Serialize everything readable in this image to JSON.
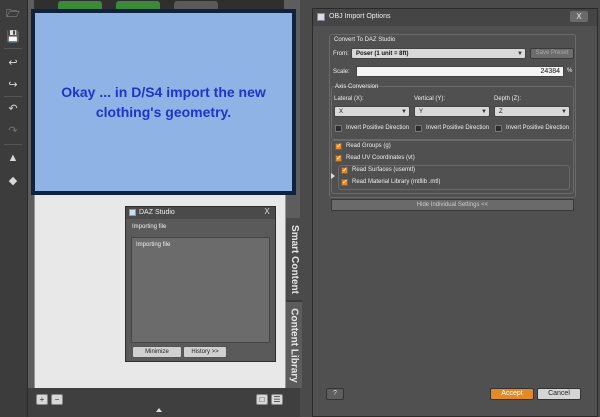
{
  "annotation": {
    "text": "Okay ... in D/S4 import the new clothing's geometry."
  },
  "side_tabs": [
    "Smart Content",
    "Content Library"
  ],
  "progress_dialog": {
    "title": "DAZ Studio",
    "close": "X",
    "label": "Importing file",
    "detail": "Importing file",
    "minimize_label": "Minimize",
    "history_label": "History >>"
  },
  "import_dialog": {
    "title": "OBJ Import Options",
    "close": "X",
    "convert_group": "Convert To DAZ Studio",
    "from_label": "From:",
    "from_value": "Poser (1 unit = 8ft)",
    "save_preset_label": "Save Preset",
    "scale_label": "Scale:",
    "scale_value": "24384",
    "scale_unit": "%",
    "axis_group": "Axis Conversion",
    "lateral_label": "Lateral (X):",
    "lateral_value": "X",
    "vertical_label": "Vertical (Y):",
    "vertical_value": "Y",
    "depth_label": "Depth (Z):",
    "depth_value": "Z",
    "invert_label": "Invert Positive Direction",
    "read_groups_label": "Read Groups (g)",
    "read_uv_label": "Read UV Coordinates (vt)",
    "read_surfaces_label": "Read Surfaces (usemtl)",
    "read_material_label": "Read Material Library (mtllib .mtl)",
    "hide_settings_label": "Hide Individual Settings <<",
    "help_label": "?",
    "accept_label": "Accept",
    "cancel_label": "Cancel"
  },
  "colors": {
    "annotation_bg": "#8fb3e5",
    "annotation_text": "#1f35c8",
    "checkbox_checked": "#e28a26"
  }
}
